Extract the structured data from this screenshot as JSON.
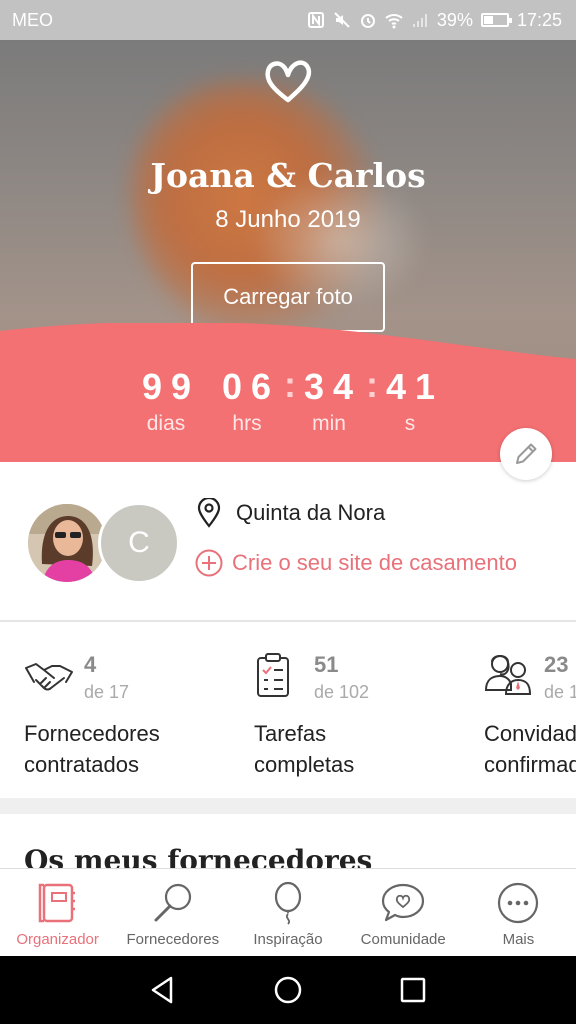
{
  "status_bar": {
    "carrier": "MEO",
    "battery": "39%",
    "time": "17:25"
  },
  "hero": {
    "couple_names": "Joana & Carlos",
    "wedding_date": "8 Junho 2019",
    "upload_button": "Carregar foto"
  },
  "countdown": {
    "days": "99",
    "days_label": "dias",
    "hours": "06",
    "hours_label": "hrs",
    "minutes": "34",
    "minutes_label": "min",
    "seconds": "41",
    "seconds_label": "s"
  },
  "couple": {
    "partner_initial": "C",
    "venue": "Quinta da Nora",
    "website_cta": "Crie o seu site de casamento"
  },
  "stats": [
    {
      "value": "4",
      "of": "de 17",
      "label_line1": "Fornecedores",
      "label_line2": "contratados"
    },
    {
      "value": "51",
      "of": "de 102",
      "label_line1": "Tarefas",
      "label_line2": "completas"
    },
    {
      "value": "23",
      "of": "de 1",
      "label_line1": "Convidados",
      "label_line2": "confirmados"
    }
  ],
  "section_title": "Os meus fornecedores",
  "bottom_nav": [
    {
      "label": "Organizador",
      "icon": "organizer-icon",
      "active": true
    },
    {
      "label": "Fornecedores",
      "icon": "search-icon",
      "active": false
    },
    {
      "label": "Inspiração",
      "icon": "balloon-icon",
      "active": false
    },
    {
      "label": "Comunidade",
      "icon": "chat-heart-icon",
      "active": false
    },
    {
      "label": "Mais",
      "icon": "more-icon",
      "active": false
    }
  ],
  "colors": {
    "accent": "#e8717a",
    "countdown_band": "#f37073"
  }
}
